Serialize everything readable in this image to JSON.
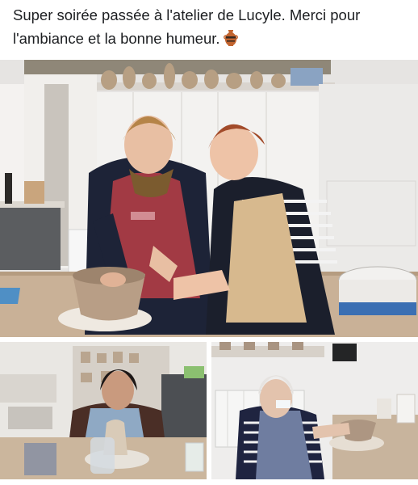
{
  "post": {
    "text": "Super soirée passée à l'atelier de Lucyle. Merci pour l'ambiance et la bonne humeur.",
    "emoji_icon": "amphora-icon"
  },
  "photos": [
    {
      "icon": "pottery-class-photo"
    },
    {
      "icon": "pottery-student-photo"
    },
    {
      "icon": "pottery-elder-photo"
    }
  ],
  "colors": {
    "text": "#1c1e21",
    "apron_red": "#a23a44",
    "clay": "#b89e86",
    "wall": "#ecebea"
  }
}
